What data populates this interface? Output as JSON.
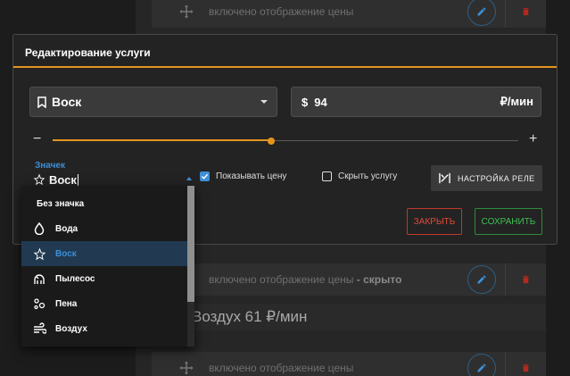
{
  "background": {
    "rows": [
      {
        "text": "включено отображение цены",
        "suffix": ""
      },
      {
        "text": "включено отображение цены",
        "suffix": " - скрыто"
      },
      {
        "text": "включено отображение цены",
        "suffix": ""
      }
    ],
    "service_title": "Воздух 61 ₽/мин"
  },
  "modal": {
    "title": "Редактирование услуги",
    "service_value": "Воск",
    "currency_symbol": "$",
    "price_value": "94",
    "price_unit": "₽/мин",
    "slider": {
      "minus": "−",
      "plus": "+",
      "value_fraction": 0.47
    },
    "icon_label": "Значек",
    "icon_value": "Воск",
    "show_price_label": "Показывать цену",
    "show_price_checked": true,
    "hide_service_label": "Скрыть услугу",
    "hide_service_checked": false,
    "relay_button": "НАСТРОЙКА РЕЛЕ",
    "close_button": "ЗАКРЫТЬ",
    "save_button": "СОХРАНИТЬ"
  },
  "dropdown": {
    "items": [
      {
        "label": "Без значка",
        "icon": "none"
      },
      {
        "label": "Вода",
        "icon": "water-drop-icon"
      },
      {
        "label": "Воск",
        "icon": "wax-icon",
        "selected": true
      },
      {
        "label": "Пылесос",
        "icon": "vacuum-icon"
      },
      {
        "label": "Пена",
        "icon": "foam-icon"
      },
      {
        "label": "Воздух",
        "icon": "air-icon"
      }
    ]
  },
  "colors": {
    "accent": "#e4951f",
    "primary": "#3d8fd6",
    "danger": "#c0392b",
    "success": "#2e8b3e"
  }
}
